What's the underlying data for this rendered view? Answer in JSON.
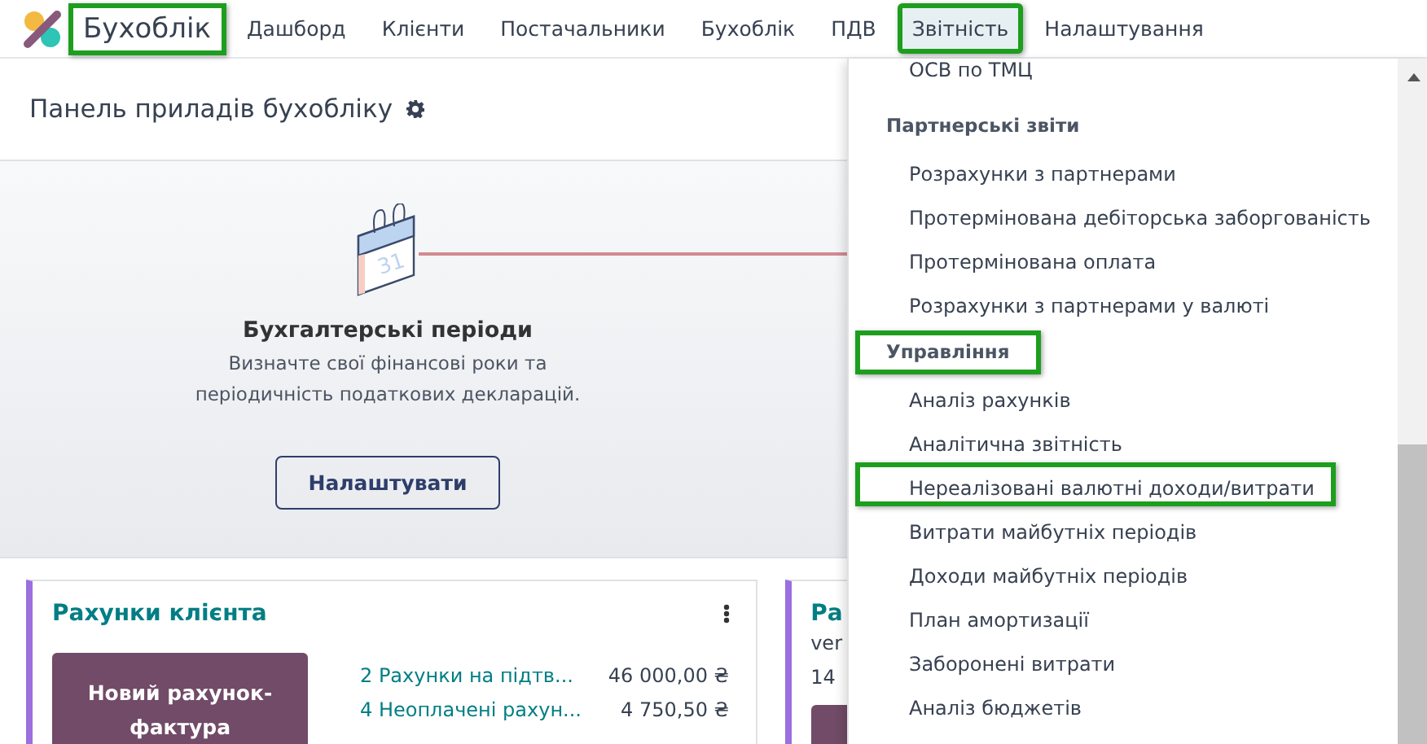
{
  "navbar": {
    "brand": {
      "label": "Бухоблік",
      "highlighted": true
    },
    "menu": [
      {
        "label": "Дашборд",
        "selected": false,
        "highlighted": false
      },
      {
        "label": "Клієнти",
        "selected": false,
        "highlighted": false
      },
      {
        "label": "Постачальники",
        "selected": false,
        "highlighted": false
      },
      {
        "label": "Бухоблік",
        "selected": false,
        "highlighted": false
      },
      {
        "label": "ПДВ",
        "selected": false,
        "highlighted": false
      },
      {
        "label": "Звітність",
        "selected": true,
        "highlighted": true
      },
      {
        "label": "Налаштування",
        "selected": false,
        "highlighted": false
      }
    ]
  },
  "page": {
    "title": "Панель приладів бухобліку"
  },
  "onboarding": {
    "calendar_day": "31",
    "title": "Бухгалтерські періоди",
    "description": "Визначте свої фінансові роки та періодичність податкових декларацій.",
    "button": "Налаштувати"
  },
  "journals": [
    {
      "title": "Рахунки клієнта",
      "button": "Новий рахунок-фактура",
      "rows": [
        {
          "label": "2 Рахунки на підтв...",
          "amount": "46 000,00 ₴"
        },
        {
          "label": "4 Неоплачені рахун...",
          "amount": "4 750,50 ₴"
        }
      ]
    },
    {
      "title": "Ра",
      "lines": [
        "ver",
        "14"
      ]
    }
  ],
  "dropdown": {
    "sections": [
      {
        "items": [
          {
            "label": "ОСВ по ТМЦ",
            "highlighted": false
          }
        ]
      },
      {
        "header": "Партнерські звіти",
        "highlighted": false,
        "items": [
          {
            "label": "Розрахунки з партнерами",
            "highlighted": false
          },
          {
            "label": "Протермінована дебіторська заборгованість",
            "highlighted": false
          },
          {
            "label": "Протермінована оплата",
            "highlighted": false
          },
          {
            "label": "Розрахунки з партнерами у валюті",
            "highlighted": false
          }
        ]
      },
      {
        "header": "Управління",
        "highlighted": true,
        "items": [
          {
            "label": "Аналіз рахунків",
            "highlighted": false
          },
          {
            "label": "Аналітична звітність",
            "highlighted": false
          },
          {
            "label": "Нереалізовані валютні доходи/витрати",
            "highlighted": true
          },
          {
            "label": "Витрати майбутніх періодів",
            "highlighted": false
          },
          {
            "label": "Доходи майбутніх періодів",
            "highlighted": false
          },
          {
            "label": "План амортизації",
            "highlighted": false
          },
          {
            "label": "Заборонені витрати",
            "highlighted": false
          },
          {
            "label": "Аналіз бюджетів",
            "highlighted": false
          }
        ]
      }
    ]
  }
}
